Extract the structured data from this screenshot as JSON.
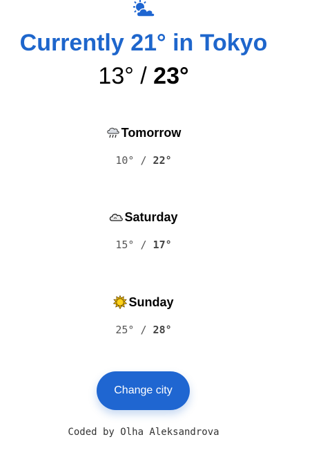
{
  "header": {
    "icon": "sun-behind-cloud-icon",
    "title": "Currently 21° in Tokyo"
  },
  "today": {
    "min": "13°",
    "separator": " / ",
    "max": "23°"
  },
  "forecast": [
    {
      "icon": "cloud-with-rain-icon",
      "day": "Tomorrow",
      "min": "10°",
      "separator": " / ",
      "max": "22°"
    },
    {
      "icon": "cloud-icon",
      "day": "Saturday",
      "min": "15°",
      "separator": " / ",
      "max": "17°"
    },
    {
      "icon": "sun-icon",
      "day": "Sunday",
      "min": "25°",
      "separator": " / ",
      "max": "28°"
    }
  ],
  "actions": {
    "change_city_label": "Change city"
  },
  "footer": {
    "credit": "Coded by Olha Aleksandrova"
  },
  "colors": {
    "title": "#1e66cc",
    "button": "#1f66d1",
    "button_text": "#ffffff"
  }
}
